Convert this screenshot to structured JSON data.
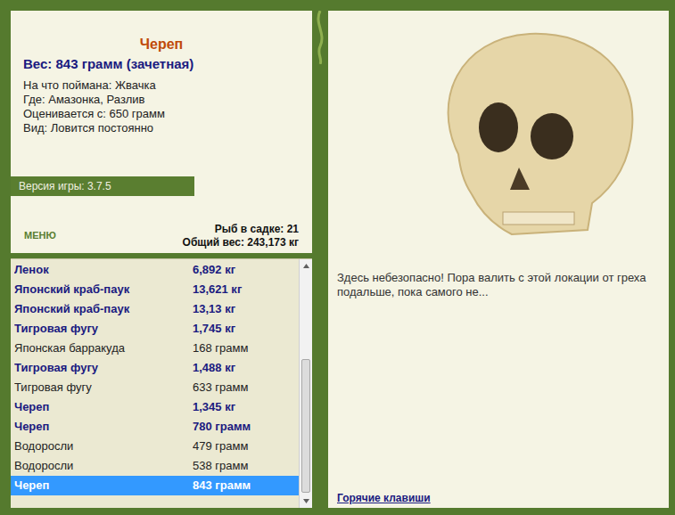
{
  "fish": {
    "name": "Череп",
    "weight": "Вес: 843 грамм (зачетная)",
    "details": [
      "На что поймана: Жвачка",
      "Где: Амазонка, Разлив",
      "Оценивается с: 650 грамм",
      "Вид: Ловится постоянно"
    ]
  },
  "version": "Версия игры: 3.7.5",
  "menu": "МЕНЮ",
  "keepnet": {
    "count": "Рыб в садке: 21",
    "total": "Общий вес: 243,173 кг"
  },
  "catch_list": [
    {
      "name": "Ленок",
      "weight": "6,892 кг",
      "counted": true,
      "selected": false
    },
    {
      "name": "Японский краб-паук",
      "weight": "13,621 кг",
      "counted": true,
      "selected": false
    },
    {
      "name": "Японский краб-паук",
      "weight": "13,13 кг",
      "counted": true,
      "selected": false
    },
    {
      "name": "Тигровая фугу",
      "weight": "1,745 кг",
      "counted": true,
      "selected": false
    },
    {
      "name": "Японская барракуда",
      "weight": "168 грамм",
      "counted": false,
      "selected": false
    },
    {
      "name": "Тигровая фугу",
      "weight": "1,488 кг",
      "counted": true,
      "selected": false
    },
    {
      "name": "Тигровая фугу",
      "weight": "633 грамм",
      "counted": false,
      "selected": false
    },
    {
      "name": "Череп",
      "weight": "1,345 кг",
      "counted": true,
      "selected": false
    },
    {
      "name": "Череп",
      "weight": "780 грамм",
      "counted": true,
      "selected": false
    },
    {
      "name": "Водоросли",
      "weight": "479 грамм",
      "counted": false,
      "selected": false
    },
    {
      "name": "Водоросли",
      "weight": "538 грамм",
      "counted": false,
      "selected": false
    },
    {
      "name": "Череп",
      "weight": "843 грамм",
      "counted": true,
      "selected": true
    }
  ],
  "description": "Здесь небезопасно! Пора валить с этой локации от греха подальше, пока самого не...",
  "hotkeys": "Горячие клавиши"
}
